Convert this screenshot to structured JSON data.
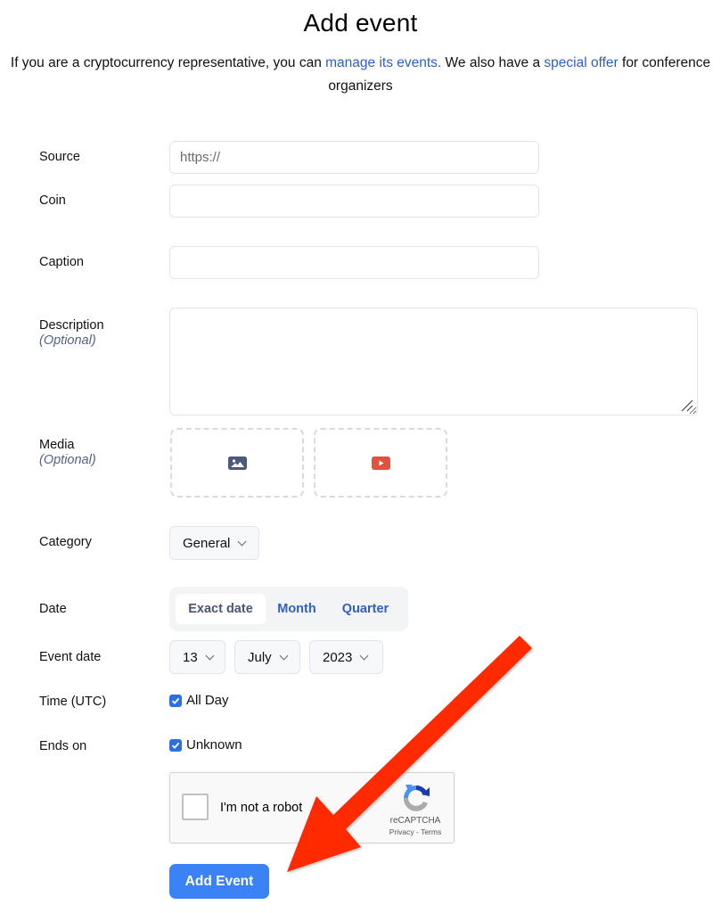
{
  "header": {
    "title": "Add event",
    "intro_before": "If you are a cryptocurrency representative, you can ",
    "link_manage": "manage its events.",
    "intro_middle": " We also have a ",
    "link_offer": "special offer",
    "intro_after": " for conference organizers"
  },
  "form": {
    "source": {
      "label": "Source",
      "placeholder": "https://",
      "value": ""
    },
    "coin": {
      "label": "Coin",
      "value": ""
    },
    "caption": {
      "label": "Caption",
      "value": ""
    },
    "description": {
      "label": "Description",
      "optional": "(Optional)",
      "value": ""
    },
    "media": {
      "label": "Media",
      "optional": "(Optional)",
      "image_icon": "image-icon",
      "video_icon": "youtube-icon"
    },
    "category": {
      "label": "Category",
      "selected": "General"
    },
    "date": {
      "label": "Date",
      "options": [
        "Exact date",
        "Month",
        "Quarter"
      ],
      "selected": "Exact date"
    },
    "event_date": {
      "label": "Event date",
      "day": "13",
      "month": "July",
      "year": "2023"
    },
    "time": {
      "label": "Time (UTC)",
      "checkbox_label": "All Day",
      "checked": true
    },
    "ends_on": {
      "label": "Ends on",
      "checkbox_label": "Unknown",
      "checked": true
    },
    "captcha": {
      "label": "I'm not a robot",
      "brand": "reCAPTCHA",
      "privacy": "Privacy",
      "separator": " - ",
      "terms": "Terms",
      "checked": false
    },
    "submit_label": "Add Event"
  },
  "annotation": {
    "type": "arrow",
    "color": "#ff2a00",
    "points_to": "add-event-button"
  },
  "colors": {
    "link": "#2f5fc4",
    "primary_button": "#3b82f6",
    "optional_text": "#556287",
    "youtube": "#e0513e",
    "image_icon": "#4b5a7a"
  }
}
